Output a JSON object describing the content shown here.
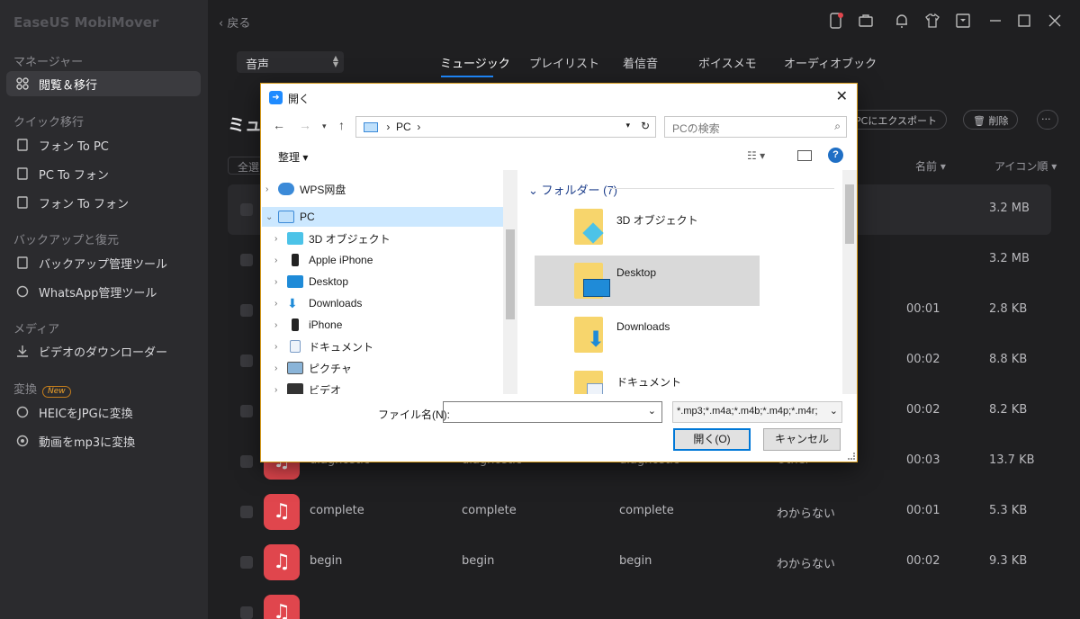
{
  "app": {
    "title": "EaseUS MobiMover"
  },
  "sidebar": {
    "sections": [
      {
        "label": "マネージャー"
      },
      {
        "label": "クイック移行"
      },
      {
        "label": "バックアップと復元"
      },
      {
        "label": "メディア"
      },
      {
        "label": "変換",
        "badge": "New"
      }
    ],
    "items": [
      {
        "label": "閲覧＆移行",
        "icon": "grid-icon",
        "active": true
      },
      {
        "label": "フォン To PC",
        "icon": "phone-to-pc-icon"
      },
      {
        "label": "PC To フォン",
        "icon": "pc-to-phone-icon"
      },
      {
        "label": "フォン To フォン",
        "icon": "phone-to-phone-icon"
      },
      {
        "label": "バックアップ管理ツール",
        "icon": "backup-icon"
      },
      {
        "label": "WhatsApp管理ツール",
        "icon": "whatsapp-icon"
      },
      {
        "label": "ビデオのダウンローダー",
        "icon": "download-icon"
      },
      {
        "label": "HEICをJPGに変換",
        "icon": "convert-icon"
      },
      {
        "label": "動画をmp3に変換",
        "icon": "convert-mp3-icon"
      }
    ]
  },
  "header": {
    "back_label": "戻る"
  },
  "type_select": {
    "value": "音声"
  },
  "tabs": [
    {
      "label": "ミュージック",
      "active": true
    },
    {
      "label": "プレイリスト"
    },
    {
      "label": "着信音"
    },
    {
      "label": "ボイスメモ"
    },
    {
      "label": "オーディオブック"
    }
  ],
  "page": {
    "title": "ミュ",
    "export_label": "PCにエクスポート",
    "delete_label": "削除",
    "more_label": "···",
    "select_all": "全選",
    "sort_name": "名前 ▾",
    "sort_view": "アイコン順 ▾"
  },
  "rows": [
    {
      "name": "",
      "c2": "",
      "c3": "",
      "genre": "",
      "duration": "",
      "size": "3.2 MB"
    },
    {
      "name": "",
      "c2": "",
      "c3": "",
      "genre": "",
      "duration": "",
      "size": "3.2 MB"
    },
    {
      "name": "",
      "c2": "",
      "c3": "",
      "genre": "",
      "duration": "00:01",
      "size": "2.8 KB"
    },
    {
      "name": "",
      "c2": "",
      "c3": "",
      "genre": "",
      "duration": "00:02",
      "size": "8.8 KB"
    },
    {
      "name": "",
      "c2": "",
      "c3": "",
      "genre": "",
      "duration": "00:02",
      "size": "8.2 KB"
    },
    {
      "name": "diagnostic",
      "c2": "diagnostic",
      "c3": "diagnostic",
      "genre": "Other",
      "duration": "00:03",
      "size": "13.7 KB"
    },
    {
      "name": "complete",
      "c2": "complete",
      "c3": "complete",
      "genre": "わからない",
      "duration": "00:01",
      "size": "5.3 KB"
    },
    {
      "name": "begin",
      "c2": "begin",
      "c3": "begin",
      "genre": "わからない",
      "duration": "00:02",
      "size": "9.3 KB"
    }
  ],
  "dialog": {
    "title": "開く",
    "address": [
      "PC"
    ],
    "search_placeholder": "PCの検索",
    "organize": "整理 ▾",
    "tree": [
      {
        "label": "WPS网盘",
        "level": 0,
        "icon": "cloud-icon"
      },
      {
        "label": "PC",
        "level": 0,
        "icon": "pc-icon",
        "expanded": true,
        "selected": true
      },
      {
        "label": "3D オブジェクト",
        "level": 1,
        "icon": "3d-objects-icon"
      },
      {
        "label": "Apple iPhone",
        "level": 1,
        "icon": "iphone-icon"
      },
      {
        "label": "Desktop",
        "level": 1,
        "icon": "desktop-icon"
      },
      {
        "label": "Downloads",
        "level": 1,
        "icon": "downloads-icon"
      },
      {
        "label": "iPhone",
        "level": 1,
        "icon": "iphone-icon"
      },
      {
        "label": "ドキュメント",
        "level": 1,
        "icon": "documents-icon"
      },
      {
        "label": "ピクチャ",
        "level": 1,
        "icon": "pictures-icon"
      },
      {
        "label": "ビデオ",
        "level": 1,
        "icon": "videos-icon"
      }
    ],
    "folders_header": "フォルダー (7)",
    "folders": [
      {
        "label": "3D オブジェクト",
        "icon": "3d-folder-icon"
      },
      {
        "label": "Desktop",
        "icon": "desktop-folder-icon",
        "selected": true
      },
      {
        "label": "Downloads",
        "icon": "downloads-folder-icon"
      },
      {
        "label": "ドキュメント",
        "icon": "documents-folder-icon"
      }
    ],
    "filename_label": "ファイル名(N):",
    "filename_value": "",
    "filetype": "*.mp3;*.m4a;*.m4b;*.m4p;*.m4r;",
    "open_label": "開く(O)",
    "cancel_label": "キャンセル"
  },
  "colors": {
    "accent": "#1f8bff",
    "sidebar_bg": "#2b2b2e",
    "main_bg": "#1f1f21",
    "music_thumb": "#e0464d",
    "dialog_border": "#d79b1c"
  }
}
